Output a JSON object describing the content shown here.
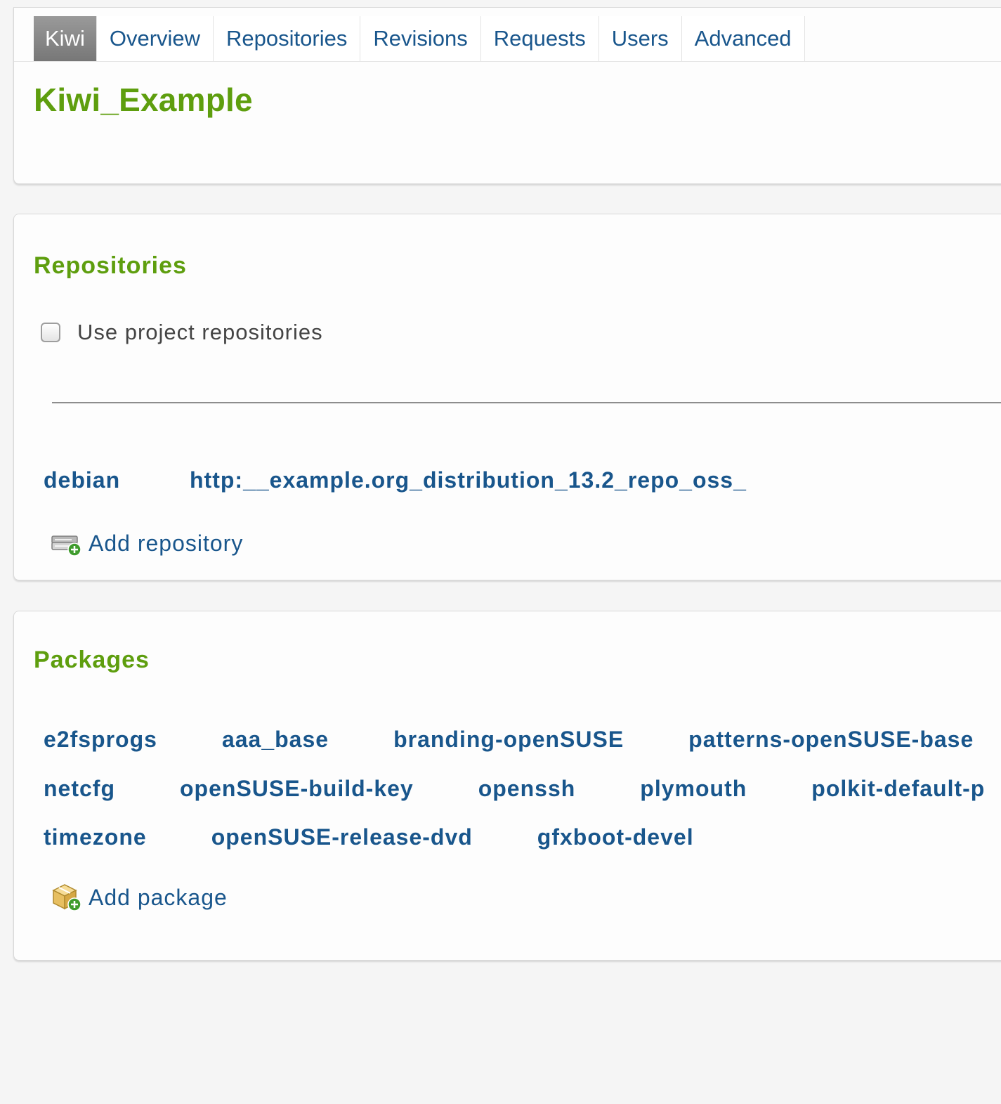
{
  "nav": {
    "tabs": [
      {
        "label": "Kiwi",
        "active": true
      },
      {
        "label": "Overview"
      },
      {
        "label": "Repositories"
      },
      {
        "label": "Revisions"
      },
      {
        "label": "Requests"
      },
      {
        "label": "Users"
      },
      {
        "label": "Advanced"
      }
    ]
  },
  "page": {
    "title": "Kiwi_Example"
  },
  "repositories": {
    "heading": "Repositories",
    "use_project_repos_label": "Use project repositories",
    "use_project_repos_checked": false,
    "items": [
      {
        "name": "debian",
        "url": "http:__example.org_distribution_13.2_repo_oss_"
      }
    ],
    "add_label": "Add repository",
    "add_icon": "add-repository-icon"
  },
  "packages": {
    "heading": "Packages",
    "rows": [
      [
        "e2fsprogs",
        "aaa_base",
        "branding-openSUSE",
        "patterns-openSUSE-base"
      ],
      [
        "netcfg",
        "openSUSE-build-key",
        "openssh",
        "plymouth",
        "polkit-default-p"
      ],
      [
        "timezone",
        "openSUSE-release-dvd",
        "gfxboot-devel"
      ]
    ],
    "add_label": "Add package",
    "add_icon": "add-package-icon"
  },
  "colors": {
    "accent_green": "#5e9e0e",
    "link_blue": "#19568c",
    "active_tab": "#8a8a8a"
  }
}
